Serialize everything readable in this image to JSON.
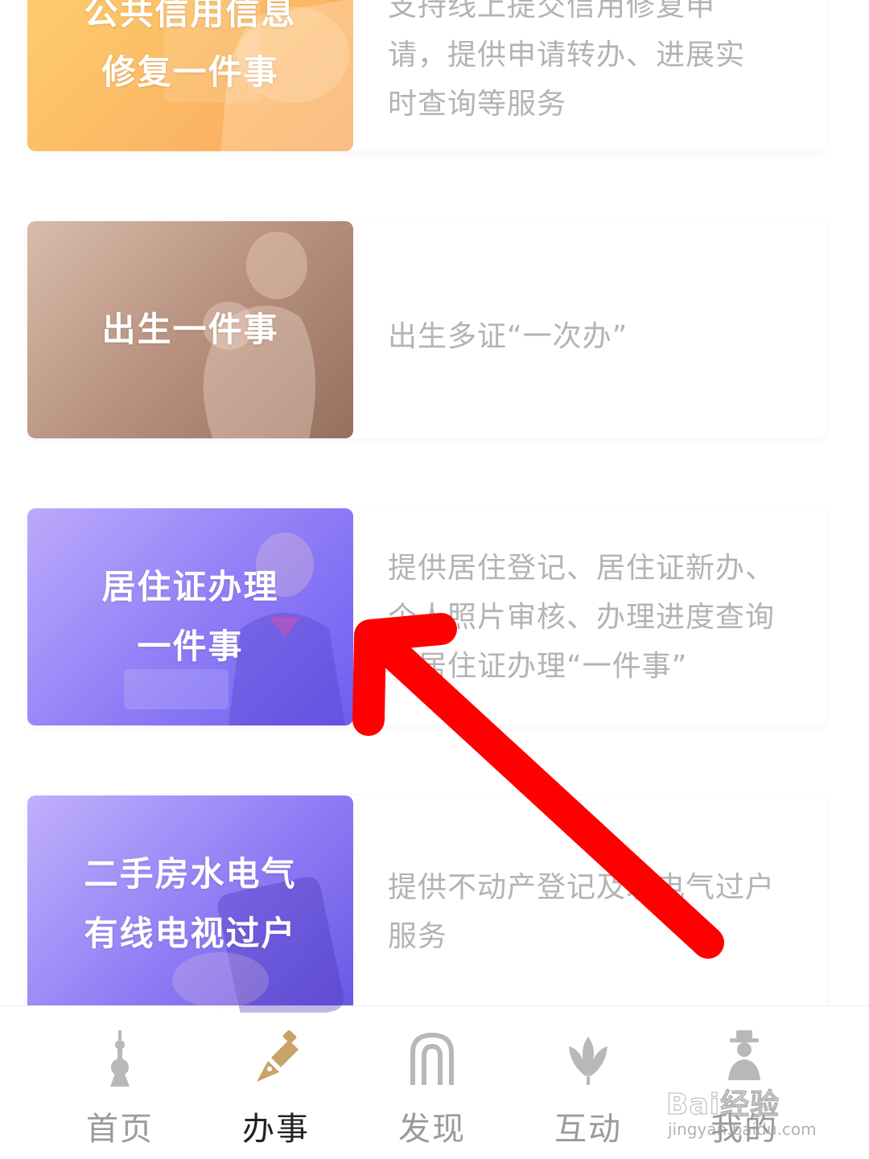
{
  "cards": [
    {
      "title_lines": [
        "公共信用信息",
        "修复一件事"
      ],
      "desc_lines": [
        "支持线上提交信用修复申",
        "请，提供申请转办、进展实",
        "时查询等服务"
      ]
    },
    {
      "title_lines": [
        "出生一件事"
      ],
      "desc_lines": [
        "出生多证“一次办”"
      ]
    },
    {
      "title_lines": [
        "居住证办理",
        "一件事"
      ],
      "desc": "提供居住登记、居住证新办、个人照片审核、办理进度查询等居住证办理“一件事”"
    },
    {
      "title_lines": [
        "二手房水电气",
        "有线电视过户"
      ],
      "desc_lines": [
        "提供不动产登记及水电气过户",
        "服务"
      ]
    }
  ],
  "tabbar": {
    "tabs": [
      {
        "label": "首页",
        "icon": "oriental-pearl-tower-icon"
      },
      {
        "label": "办事",
        "icon": "fountain-pen-icon",
        "active": true
      },
      {
        "label": "发现",
        "icon": "arch-building-icon"
      },
      {
        "label": "互动",
        "icon": "magnolia-flower-icon"
      },
      {
        "label": "我的",
        "icon": "person-hat-icon"
      }
    ]
  },
  "watermark": {
    "text": "Bai经验",
    "sub": "jingyan.baidu.com"
  },
  "colors": {
    "card1_gradient": [
      "#ffc55e",
      "#f7a45a"
    ],
    "card2_gradient": [
      "#d4b6a3",
      "#9c7667"
    ],
    "card3_gradient": [
      "#b5a4fb",
      "#6e5ef0"
    ],
    "card4_gradient": [
      "#b9a8fb",
      "#6b5ae6"
    ],
    "description_text": "#b3b3b3",
    "annotation_arrow": "#ff0000",
    "tab_active_icon": "#c9a26a"
  }
}
